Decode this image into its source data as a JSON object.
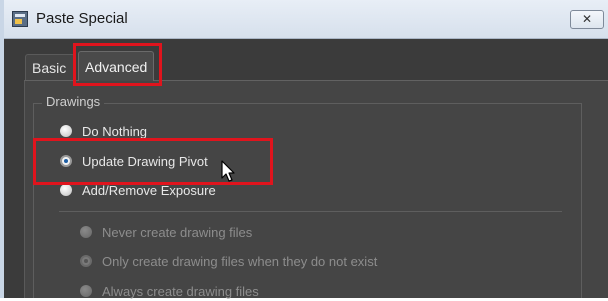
{
  "window": {
    "title": "Paste Special",
    "close_glyph": "✕"
  },
  "tabs": [
    {
      "label": "Basic",
      "active": false
    },
    {
      "label": "Advanced",
      "active": true
    }
  ],
  "drawings_group": {
    "title": "Drawings",
    "options": [
      {
        "label": "Do Nothing",
        "checked": false
      },
      {
        "label": "Update Drawing Pivot",
        "checked": true
      },
      {
        "label": "Add/Remove Exposure",
        "checked": false
      }
    ],
    "sub_options": [
      {
        "label": "Never create drawing files",
        "checked": false,
        "enabled": false
      },
      {
        "label": "Only create drawing files when they do not exist",
        "checked": true,
        "enabled": false
      },
      {
        "label": "Always create drawing files",
        "checked": false,
        "enabled": false
      }
    ]
  },
  "annotations": {
    "highlight_color": "#e0141d"
  },
  "icons": {
    "app": "paste-special-app-icon",
    "close": "close-icon",
    "cursor": "mouse-pointer-icon"
  }
}
